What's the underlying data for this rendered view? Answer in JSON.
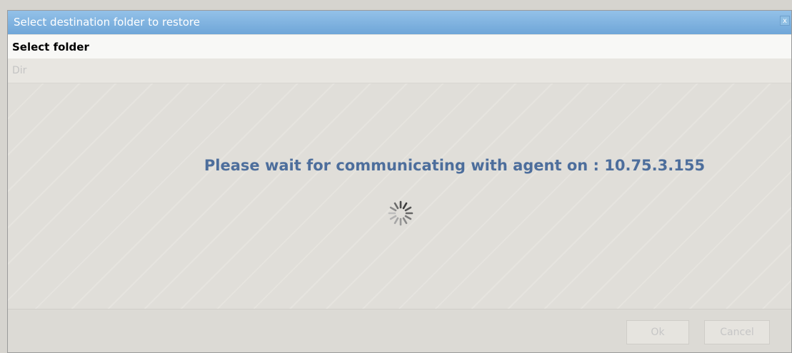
{
  "dialog": {
    "title": "Select destination folder to restore",
    "close_label": "x",
    "header": "Select folder",
    "column_label": "Dir",
    "wait_message": "Please wait for communicating with agent on : 10.75.3.155",
    "buttons": {
      "ok_label": "Ok",
      "cancel_label": "Cancel"
    }
  },
  "colors": {
    "title_bar": "#7fb3e0",
    "message_text": "#4d6e9c",
    "disabled_text": "#c6c6c6"
  },
  "icons": {
    "close": "close-icon",
    "loading": "loading-spinner-icon"
  }
}
